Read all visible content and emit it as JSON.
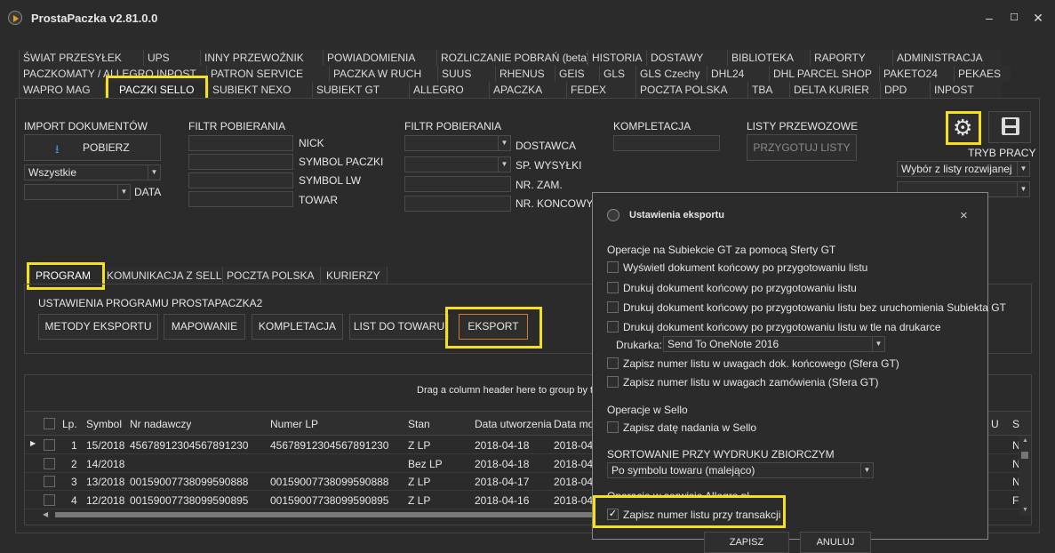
{
  "app": {
    "title": "ProstaPaczka v2.81.0.0"
  },
  "window_controls": {
    "minimize": "–",
    "maximize": "☐",
    "close": "✕"
  },
  "tabs": {
    "row1": [
      "ŚWIAT PRZESYŁEK",
      "UPS",
      "INNY PRZEWOŹNIK",
      "POWIADOMIENIA",
      "ROZLICZANIE POBRAŃ (beta)",
      "HISTORIA",
      "DOSTAWY",
      "BIBLIOTEKA",
      "RAPORTY",
      "ADMINISTRACJA"
    ],
    "row2": [
      "PACZKOMATY / ALLEGRO INPOST",
      "PATRON SERVICE",
      "PACZKA W RUCH",
      "SUUS",
      "RHENUS",
      "GEIS",
      "GLS",
      "GLS Czechy",
      "DHL24",
      "DHL PARCEL SHOP",
      "PAKETO24",
      "PEKAES"
    ],
    "row3": [
      "WAPRO MAG",
      "PACZKI SELLO",
      "SUBIEKT NEXO",
      "SUBIEKT GT",
      "ALLEGRO",
      "APACZKA",
      "FEDEX",
      "POCZTA POLSKA",
      "TBA",
      "DELTA KURIER",
      "DPD",
      "INPOST"
    ]
  },
  "import": {
    "heading": "IMPORT DOKUMENTÓW",
    "fetch_label": "POBIERZ",
    "filter_value": "Wszystkie",
    "date_label": "DATA"
  },
  "filter1": {
    "heading": "FILTR POBIERANIA",
    "labels": [
      "NICK",
      "SYMBOL PACZKI",
      "SYMBOL LW",
      "TOWAR"
    ]
  },
  "filter2": {
    "heading": "FILTR POBIERANIA",
    "labels": [
      "DOSTAWCA",
      "SP. WYSYŁKI",
      "NR. ZAM.",
      "NR. KONCOWY"
    ]
  },
  "kompletacja": {
    "heading": "KOMPLETACJA"
  },
  "listy": {
    "heading": "LISTY PRZEWOZOWE",
    "prepare_label": "PRZYGOTUJ LISTY"
  },
  "tryb": {
    "heading": "TRYB PRACY",
    "value": "Wybór z listy rozwijanej"
  },
  "subtabs": [
    "PROGRAM",
    "KOMUNIKACJA Z SELLO",
    "POCZTA POLSKA",
    "KURIERZY"
  ],
  "settings": {
    "heading": "USTAWIENIA PROGRAMU PROSTAPACZKA2",
    "buttons": [
      "METODY EKSPORTU",
      "MAPOWANIE",
      "KOMPLETACJA",
      "LIST DO TOWARU",
      "EKSPORT"
    ]
  },
  "grid": {
    "group_hint": "Drag a column header here to group by t",
    "columns": [
      "Lp.",
      "Symbol",
      "Nr nadawczy",
      "Numer LP",
      "Stan",
      "Data utworzenia",
      "Data mod",
      "U",
      "S"
    ],
    "rows": [
      [
        "1",
        "15/2018",
        "4567891230456789123​0",
        "45678912304567891230",
        "Z LP",
        "2018-04-18",
        "2018-04-",
        "",
        "N"
      ],
      [
        "2",
        "14/2018",
        "",
        "",
        "Bez LP",
        "2018-04-18",
        "2018-04-",
        "",
        "N"
      ],
      [
        "3",
        "13/2018",
        "00159007738099590888",
        "00159007738099590888",
        "Z LP",
        "2018-04-17",
        "2018-04-",
        "",
        "N"
      ],
      [
        "4",
        "12/2018",
        "00159007738099590895",
        "00159007738099590895",
        "Z LP",
        "2018-04-16",
        "2018-04-",
        "",
        "F"
      ]
    ]
  },
  "dialog": {
    "title": "Ustawienia eksportu",
    "close": "×",
    "section1": "Operacje na Subiekcie GT za pomocą Sferty GT",
    "options1": [
      {
        "label": "Wyświetl dokument końcowy po przygotowaniu listu",
        "checked": false
      },
      {
        "label": "Drukuj dokument końcowy po przygotowaniu listu",
        "checked": false
      },
      {
        "label": "Drukuj dokument końcowy po przygotowaniu listu bez uruchomienia Subiekta GT",
        "checked": false
      },
      {
        "label": "Drukuj dokument końcowy po przygotowaniu listu w tle na drukarce",
        "checked": false
      }
    ],
    "printer_label": "Drukarka:",
    "printer_value": "Send To OneNote 2016",
    "options2": [
      {
        "label": "Zapisz numer listu w uwagach dok. końcowego (Sfera GT)",
        "checked": false
      },
      {
        "label": "Zapisz numer listu w uwagach zamówienia (Sfera GT)",
        "checked": false
      }
    ],
    "section2": "Operacje w Sello",
    "options3": [
      {
        "label": "Zapisz datę nadania w Sello",
        "checked": false
      }
    ],
    "section3": "SORTOWANIE PRZY WYDRUKU ZBIORCZYM",
    "sort_value": "Po symbolu towaru (malejąco)",
    "section4": "Operacje w serwisie Allegro.pl",
    "options4": [
      {
        "label": "Zapisz numer listu przy transakcji",
        "checked": true
      }
    ],
    "save_label": "ZAPISZ",
    "cancel_label": "ANULUJ"
  },
  "colors": {
    "highlight": "#f5e11b",
    "background": "#2b2b2b",
    "accent_orange": "#d07a2a",
    "icon_blue": "#4a90d9"
  }
}
